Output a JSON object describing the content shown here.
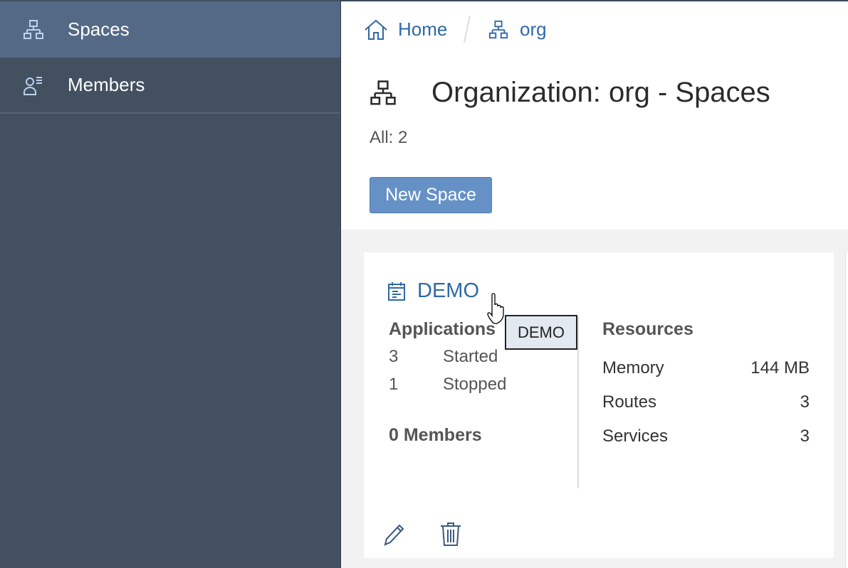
{
  "sidebar": {
    "items": [
      {
        "label": "Spaces",
        "icon": "hierarchy-icon",
        "selected": true
      },
      {
        "label": "Members",
        "icon": "members-icon",
        "selected": false
      }
    ]
  },
  "breadcrumb": {
    "home": "Home",
    "org": "org"
  },
  "page": {
    "title": "Organization: org - Spaces",
    "count": "All: 2",
    "new_button": "New Space"
  },
  "card": {
    "name": "DEMO",
    "applications_heading": "Applications",
    "apps": [
      {
        "count": "3",
        "state": "Started"
      },
      {
        "count": "1",
        "state": "Stopped"
      }
    ],
    "members": "0 Members",
    "resources_heading": "Resources",
    "resources": [
      {
        "label": "Memory",
        "value": "144 MB"
      },
      {
        "label": "Routes",
        "value": "3"
      },
      {
        "label": "Services",
        "value": "3"
      }
    ]
  },
  "tooltip": "DEMO",
  "colors": {
    "sidebar": "#435060",
    "sidebar_selected": "#536985",
    "link": "#2f69a6",
    "button": "#6591c6"
  }
}
